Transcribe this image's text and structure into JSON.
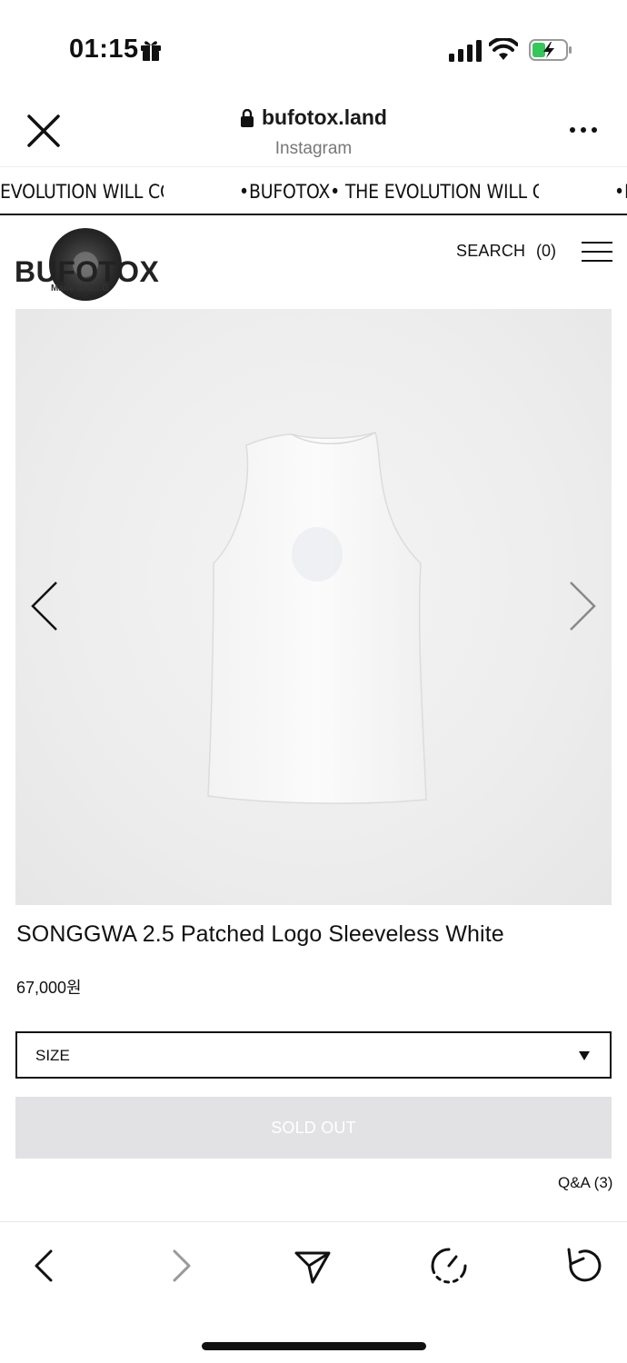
{
  "status_bar": {
    "time": "01:15",
    "icons": [
      "gift-icon",
      "cellular-signal-icon",
      "wifi-icon",
      "battery-charging-icon"
    ]
  },
  "browser": {
    "url": "bufotox.land",
    "source": "Instagram",
    "icons": [
      "close-icon",
      "lock-icon",
      "more-icon"
    ]
  },
  "marquee": {
    "items": [
      "EVOLUTION WILL CC",
      "•BUFOTOX• THE EVOLUTION WILL CC",
      "•E"
    ]
  },
  "site": {
    "logo_text": "BUFOTOX",
    "logo_sub": "Made in G.I.G",
    "search_label": "SEARCH",
    "cart_label": "(0)",
    "icons": [
      "menu-icon"
    ]
  },
  "product": {
    "image_icons": [
      "chevron-left-icon",
      "chevron-right-icon"
    ],
    "title": "SONGGWA 2.5 Patched Logo Sleeveless White",
    "price": "67,000원",
    "size_label": "SIZE",
    "soldout_label": "SOLD OUT",
    "qa_label": "Q&A (3)"
  },
  "toolbar": {
    "icons": [
      "back-icon",
      "forward-icon",
      "share-icon",
      "speed-icon",
      "reload-icon"
    ]
  },
  "colors": {
    "text": "#111111",
    "muted": "#777777",
    "soldout_bg": "#e2e2e4",
    "battery_green": "#34c759",
    "image_bg": "#eeeeee"
  }
}
